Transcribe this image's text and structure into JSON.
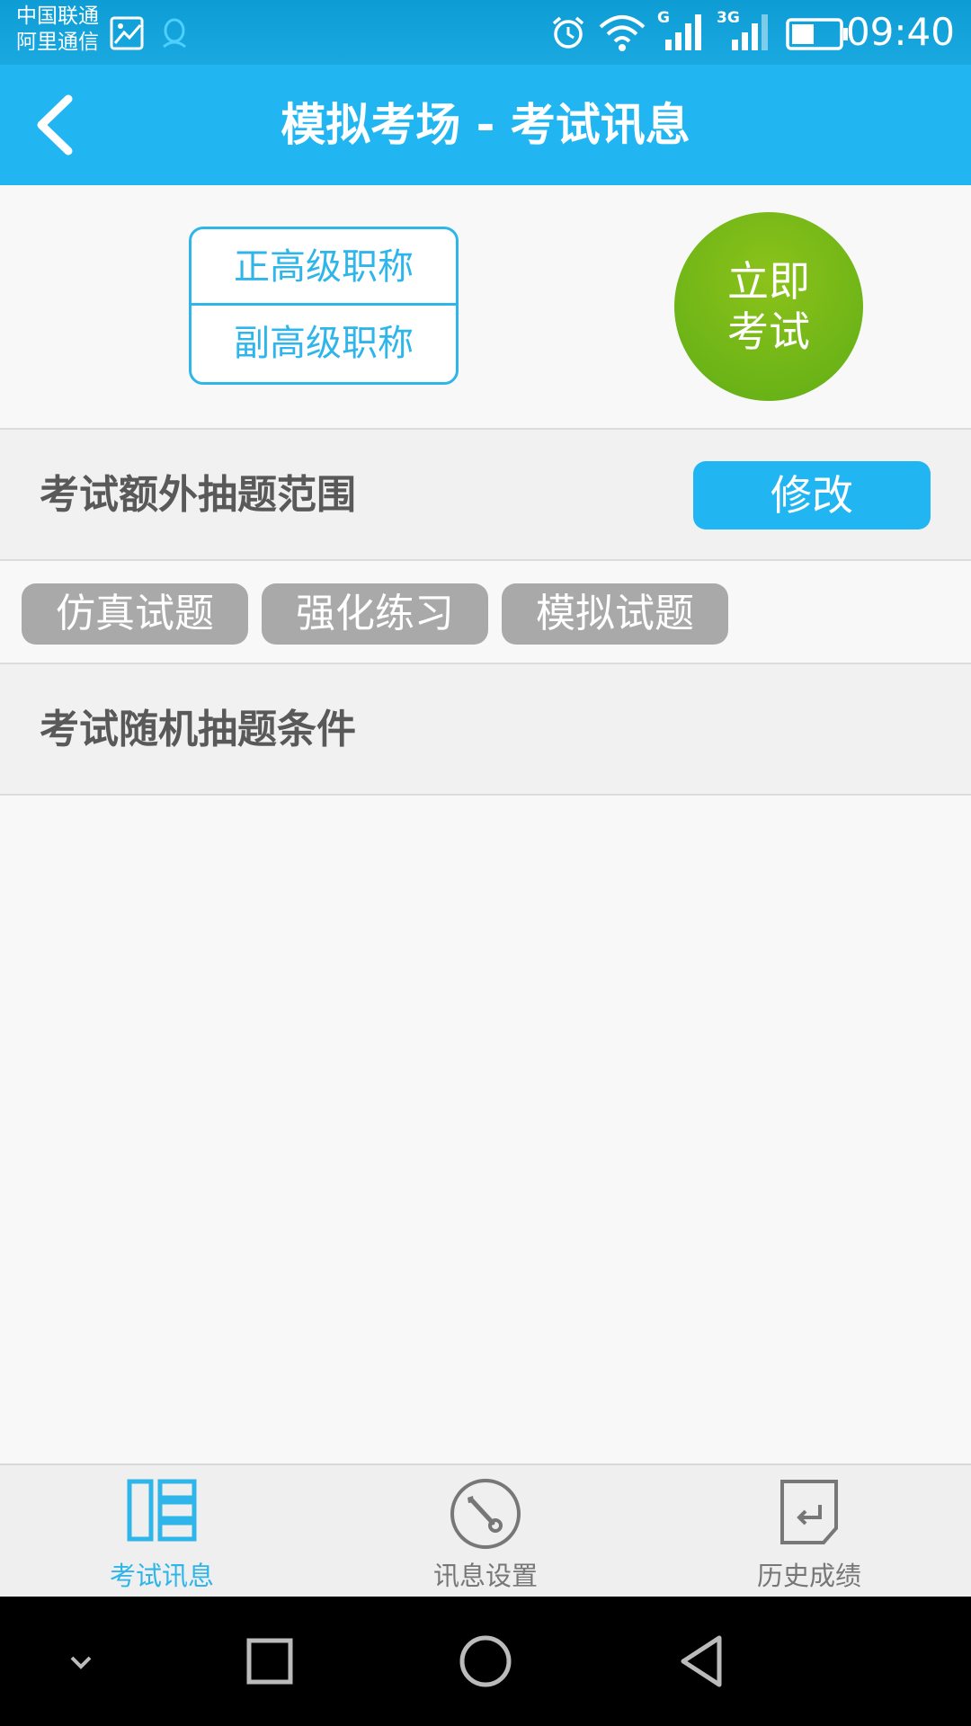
{
  "status_bar": {
    "carrier_1": "中国联通",
    "carrier_2": "阿里通信",
    "time": "09:40",
    "network_1": "G",
    "network_2": "3G"
  },
  "header": {
    "title": "模拟考场 - 考试讯息"
  },
  "level_selector": {
    "options": [
      "正高级职称",
      "副高级职称"
    ]
  },
  "start_button": {
    "line1": "立即",
    "line2": "考试"
  },
  "extra_range": {
    "label": "考试额外抽题范围",
    "modify_label": "修改",
    "tags": [
      "仿真试题",
      "强化练习",
      "模拟试题"
    ]
  },
  "random_conditions": {
    "label": "考试随机抽题条件"
  },
  "tab_bar": {
    "items": [
      {
        "label": "考试讯息",
        "icon": "layout-icon",
        "active": true
      },
      {
        "label": "讯息设置",
        "icon": "wrench-icon",
        "active": false
      },
      {
        "label": "历史成绩",
        "icon": "history-icon",
        "active": false
      }
    ]
  },
  "colors": {
    "primary": "#21b6f2",
    "start_green": "#6db516",
    "tag_gray": "#a9a9a9"
  }
}
